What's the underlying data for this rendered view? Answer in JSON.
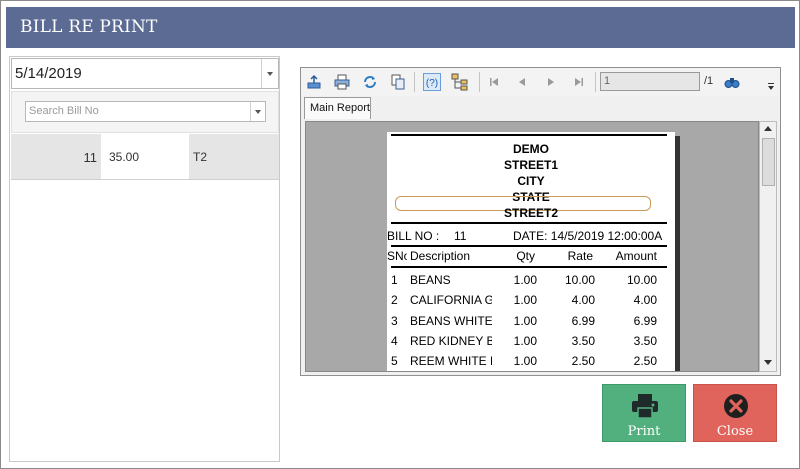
{
  "window": {
    "title": "BILL RE PRINT"
  },
  "left": {
    "date_value": "5/14/2019",
    "search_placeholder": "Search Bill No",
    "bills": [
      {
        "bill_no": "11",
        "amount": "35.00",
        "table": "T2"
      }
    ]
  },
  "viewer": {
    "page_input": "1",
    "page_total": "/1",
    "tab_label": "Main Report",
    "icons": [
      "export-icon",
      "print-icon",
      "refresh-icon",
      "copy-icon",
      "help-icon",
      "group-tree-icon",
      "first-page-icon",
      "previous-page-icon",
      "next-page-icon",
      "last-page-icon",
      "search-icon"
    ]
  },
  "receipt": {
    "header": [
      "DEMO",
      "STREET1",
      "CITY",
      "STATE",
      "STREET2"
    ],
    "bill_no_label": "BILL NO :",
    "bill_no": "11",
    "date_text": "DATE: 14/5/2019 12:00:00A",
    "columns": {
      "sno": "SNo",
      "description": "Description",
      "qty": "Qty",
      "rate": "Rate",
      "amount": "Amount"
    },
    "items": [
      {
        "sno": "1",
        "description": "BEANS",
        "qty": "1.00",
        "rate": "10.00",
        "amount": "10.00"
      },
      {
        "sno": "2",
        "description": "CALIFORNIA GA",
        "qty": "1.00",
        "rate": "4.00",
        "amount": "4.00"
      },
      {
        "sno": "3",
        "description": "BEANS WHITE",
        "qty": "1.00",
        "rate": "6.99",
        "amount": "6.99"
      },
      {
        "sno": "4",
        "description": "RED KIDNEY BE",
        "qty": "1.00",
        "rate": "3.50",
        "amount": "3.50"
      },
      {
        "sno": "5",
        "description": "REEM WHITE B",
        "qty": "1.00",
        "rate": "2.50",
        "amount": "2.50"
      }
    ]
  },
  "actions": {
    "print_label": "Print",
    "close_label": "Close"
  },
  "colors": {
    "titlebar": "#5b6b93",
    "print_button": "#52b07e",
    "close_button": "#e0645b"
  }
}
